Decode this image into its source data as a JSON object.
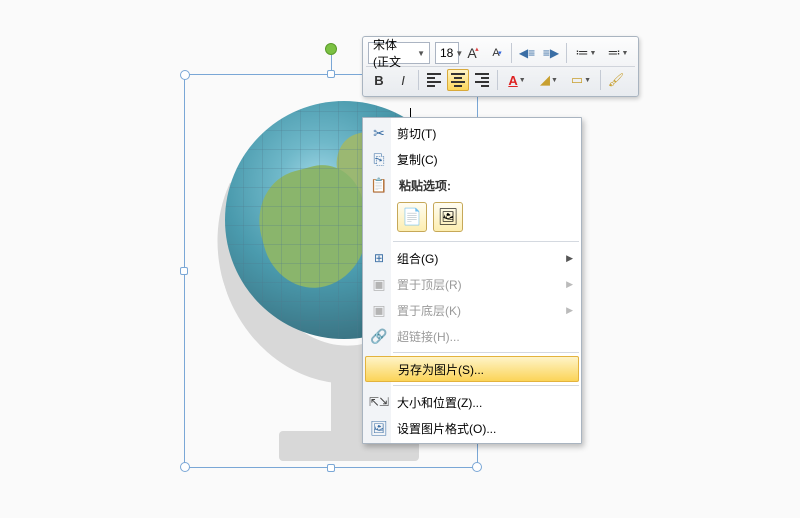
{
  "toolbar": {
    "font_name": "宋体 (正文",
    "font_size": "18"
  },
  "menu": {
    "cut": "剪切(T)",
    "copy": "复制(C)",
    "paste_header": "粘贴选项:",
    "group": "组合(G)",
    "bring_front": "置于顶层(R)",
    "send_back": "置于底层(K)",
    "hyperlink": "超链接(H)...",
    "save_as_pic": "另存为图片(S)...",
    "size_pos": "大小和位置(Z)...",
    "format_pic": "设置图片格式(O)..."
  }
}
